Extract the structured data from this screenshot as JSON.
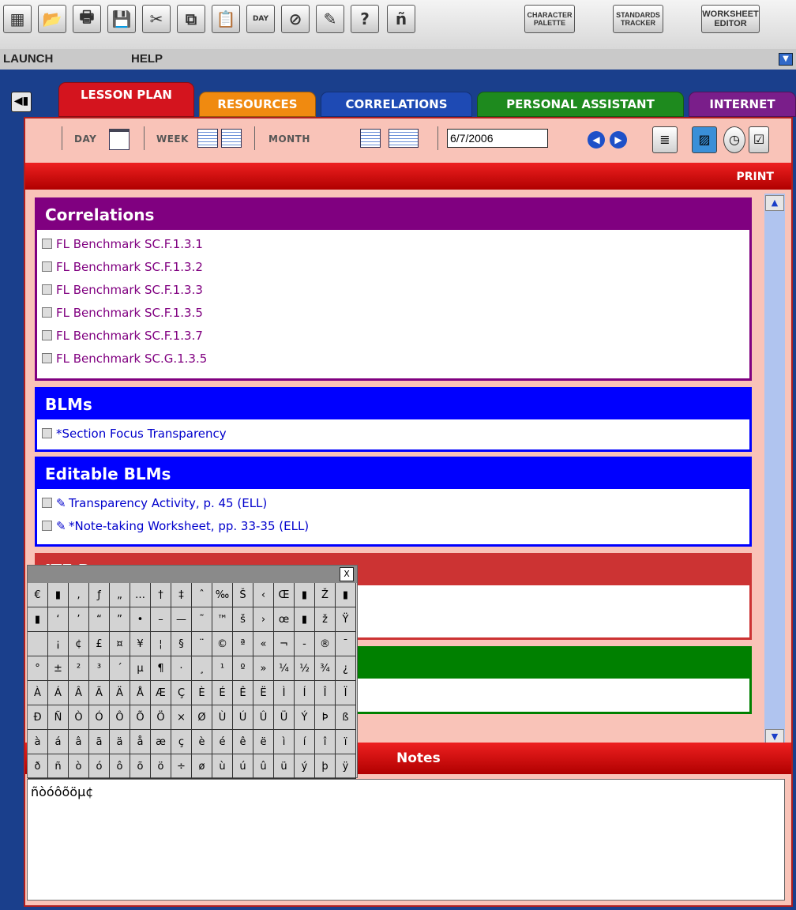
{
  "toolbar": {
    "buttons": [
      {
        "name": "calendar-icon",
        "glyph": "▦"
      },
      {
        "name": "open-folder-icon",
        "glyph": "📂"
      },
      {
        "name": "print-icon",
        "glyph": "🖶"
      },
      {
        "name": "save-icon",
        "glyph": "💾"
      },
      {
        "name": "cut-icon",
        "glyph": "✂"
      },
      {
        "name": "copy-icon",
        "glyph": "⧉"
      },
      {
        "name": "paste-icon",
        "glyph": "📋"
      },
      {
        "name": "new-day-icon",
        "glyph": "DAY"
      },
      {
        "name": "no-entry-icon",
        "glyph": "⊘"
      },
      {
        "name": "tools-icon",
        "glyph": "✎"
      },
      {
        "name": "help-icon",
        "glyph": "?"
      },
      {
        "name": "special-char-icon",
        "glyph": "ñ"
      }
    ],
    "character_palette": "CHARACTER PALETTE",
    "standards_tracker": "STANDARDS TRACKER",
    "worksheet_editor": "WORKSHEET EDITOR"
  },
  "menu": {
    "launch": "LAUNCH",
    "help": "HELP"
  },
  "tabs": [
    {
      "label": "LESSON PLAN",
      "color": "#d4141e"
    },
    {
      "label": "RESOURCES",
      "color": "#f08a10"
    },
    {
      "label": "CORRELATIONS",
      "color": "#1e4ab4"
    },
    {
      "label": "PERSONAL ASSISTANT",
      "color": "#1e8a1e"
    },
    {
      "label": "INTERNET",
      "color": "#7a1e8a"
    }
  ],
  "datebar": {
    "day": "DAY",
    "week": "WEEK",
    "month": "MONTH",
    "date_value": "6/7/2006"
  },
  "print_label": "PRINT",
  "sections": {
    "correlations": {
      "title": "Correlations",
      "color": "#800080",
      "items": [
        "FL Benchmark SC.F.1.3.1",
        "FL Benchmark SC.F.1.3.2",
        "FL Benchmark SC.F.1.3.3",
        "FL Benchmark SC.F.1.3.5",
        "FL Benchmark SC.F.1.3.7",
        "FL Benchmark SC.G.1.3.5"
      ]
    },
    "blms": {
      "title": "BLMs",
      "color": "#0000ff",
      "items": [
        "*Section Focus Transparency"
      ]
    },
    "editable_blms": {
      "title": "Editable BLMs",
      "color": "#0000ff",
      "items": [
        "Transparency Activity, p. 45 (ELL)",
        "*Note-taking Worksheet, pp. 33-35 (ELL)"
      ]
    },
    "ite": {
      "title": "ITE R",
      "color": "#cc3333"
    },
    "green": {
      "title": "",
      "color": "#008000"
    }
  },
  "notes": {
    "label": "Notes",
    "content": "ñòóôõöµ¢"
  },
  "char_palette": {
    "close": "X",
    "rows": [
      [
        "€",
        "▮",
        "‚",
        "ƒ",
        "„",
        "…",
        "†",
        "‡",
        "ˆ",
        "‰",
        "Š",
        "‹",
        "Œ",
        "▮",
        "Ž",
        "▮"
      ],
      [
        "▮",
        "‘",
        "’",
        "“",
        "”",
        "•",
        "–",
        "—",
        "˜",
        "™",
        "š",
        "›",
        "œ",
        "▮",
        "ž",
        "Ÿ"
      ],
      [
        " ",
        "¡",
        "¢",
        "£",
        "¤",
        "¥",
        "¦",
        "§",
        "¨",
        "©",
        "ª",
        "«",
        "¬",
        "-",
        "®",
        "¯"
      ],
      [
        "°",
        "±",
        "²",
        "³",
        "´",
        "µ",
        "¶",
        "·",
        "¸",
        "¹",
        "º",
        "»",
        "¼",
        "½",
        "¾",
        "¿"
      ],
      [
        "À",
        "Á",
        "Â",
        "Ã",
        "Ä",
        "Å",
        "Æ",
        "Ç",
        "È",
        "É",
        "Ê",
        "Ë",
        "Ì",
        "Í",
        "Î",
        "Ï"
      ],
      [
        "Ð",
        "Ñ",
        "Ò",
        "Ó",
        "Ô",
        "Õ",
        "Ö",
        "×",
        "Ø",
        "Ù",
        "Ú",
        "Û",
        "Ü",
        "Ý",
        "Þ",
        "ß"
      ],
      [
        "à",
        "á",
        "â",
        "ã",
        "ä",
        "å",
        "æ",
        "ç",
        "è",
        "é",
        "ê",
        "ë",
        "ì",
        "í",
        "î",
        "ï"
      ],
      [
        "ð",
        "ñ",
        "ò",
        "ó",
        "ô",
        "õ",
        "ö",
        "÷",
        "ø",
        "ù",
        "ú",
        "û",
        "ü",
        "ý",
        "þ",
        "ÿ"
      ]
    ]
  }
}
